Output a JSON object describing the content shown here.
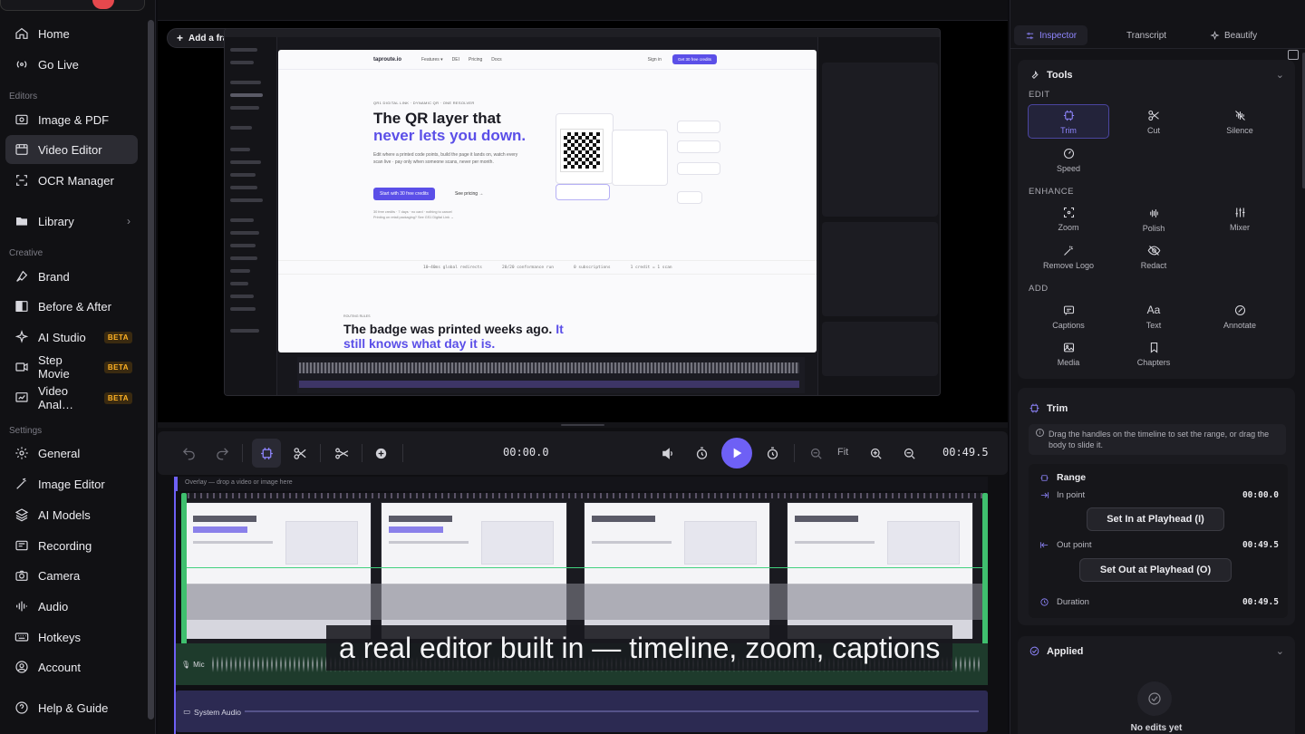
{
  "sidebar": {
    "items_top": [
      {
        "label": "Home",
        "icon": "home-icon"
      },
      {
        "label": "Go Live",
        "icon": "broadcast-icon"
      }
    ],
    "sections": {
      "editors": "Editors",
      "creative": "Creative",
      "settings": "Settings"
    },
    "editors": [
      {
        "label": "Image & PDF",
        "icon": "image-icon"
      },
      {
        "label": "Video Editor",
        "icon": "film-icon",
        "active": true
      },
      {
        "label": "OCR Manager",
        "icon": "scan-icon"
      }
    ],
    "library": {
      "label": "Library",
      "icon": "folder-icon"
    },
    "creative": [
      {
        "label": "Brand",
        "icon": "brush-icon"
      },
      {
        "label": "Before & After",
        "icon": "split-icon"
      },
      {
        "label": "AI Studio",
        "icon": "sparkle-icon",
        "badge": "BETA"
      },
      {
        "label": "Step Movie",
        "icon": "steps-icon",
        "badge": "BETA"
      },
      {
        "label": "Video Anal…",
        "icon": "chart-icon",
        "badge": "BETA"
      }
    ],
    "settings": [
      {
        "label": "General",
        "icon": "gear-icon"
      },
      {
        "label": "Image Editor",
        "icon": "wand-icon"
      },
      {
        "label": "AI Models",
        "icon": "layers-icon"
      },
      {
        "label": "Recording",
        "icon": "record-icon"
      },
      {
        "label": "Camera",
        "icon": "camera-icon"
      },
      {
        "label": "Audio",
        "icon": "audio-icon"
      },
      {
        "label": "Hotkeys",
        "icon": "keyboard-icon"
      },
      {
        "label": "Account",
        "icon": "user-icon"
      }
    ],
    "help": {
      "label": "Help & Guide",
      "icon": "help-icon"
    }
  },
  "preview": {
    "add_frame_label": "Add a frame",
    "webpage": {
      "logo": "taproute.io",
      "nav_links": [
        "Features ▾",
        "DEI",
        "Pricing",
        "Docs"
      ],
      "sign_in": "Sign in",
      "cta": "Get 30 free credits",
      "kicker": "QR1 DIGITAL LINK · DYNAMIC QR · ONE RESOLVER",
      "headline_1": "The QR layer that",
      "headline_2": "never lets you down.",
      "subtext": "Edit where a printed code points, build the page it lands on, watch every scan live · pay only when someone scans, never per month.",
      "primary_button": "Start with 30 free credits",
      "secondary_link": "See pricing →",
      "fine_print_1": "30 free credits · 7 days · no card · nothing to cancel",
      "fine_print_2": "Printing on retail packaging? See GS1 Digital Link →",
      "stats": [
        "10–40ms global redirects",
        "20/20 conformance run",
        "0 subscriptions",
        "1 credit = 1 scan"
      ],
      "kicker_2": "ROUTING RULES",
      "headline2_1": "The badge was printed weeks ago.",
      "headline2_2": "It still knows what day it is."
    }
  },
  "toolbar": {
    "current_time": "00:00.0",
    "total_time": "00:49.5",
    "fit_label": "Fit"
  },
  "timeline": {
    "overlay_label": "Overlay — drop a video or image here",
    "mic_label": "Mic",
    "system_audio_label": "System Audio",
    "caption": "a real editor built in — timeline, zoom, captions"
  },
  "inspector": {
    "tabs": [
      {
        "label": "Inspector",
        "icon": "sliders-icon"
      },
      {
        "label": "Transcript",
        "icon": "text-icon"
      },
      {
        "label": "Beautify",
        "icon": "sparkle-icon"
      }
    ],
    "tools_title": "Tools",
    "groups": {
      "edit": "EDIT",
      "enhance": "ENHANCE",
      "add": "ADD"
    },
    "edit_tools": [
      {
        "label": "Trim",
        "icon": "trim-icon",
        "active": true
      },
      {
        "label": "Cut",
        "icon": "scissors-icon"
      },
      {
        "label": "Silence",
        "icon": "silence-icon"
      },
      {
        "label": "Speed",
        "icon": "speed-icon"
      }
    ],
    "enhance_tools": [
      {
        "label": "Zoom",
        "icon": "zoom-icon"
      },
      {
        "label": "Polish",
        "icon": "polish-icon"
      },
      {
        "label": "Mixer",
        "icon": "mixer-icon"
      },
      {
        "label": "Remove Logo",
        "icon": "remove-logo-icon"
      },
      {
        "label": "Redact",
        "icon": "eye-off-icon"
      }
    ],
    "add_tools": [
      {
        "label": "Captions",
        "icon": "captions-icon"
      },
      {
        "label": "Text",
        "icon": "text-aa-icon",
        "glyph": "Aa"
      },
      {
        "label": "Annotate",
        "icon": "annotate-icon"
      },
      {
        "label": "Media",
        "icon": "media-icon"
      },
      {
        "label": "Chapters",
        "icon": "bookmark-icon"
      }
    ],
    "trim": {
      "title": "Trim",
      "hint": "Drag the handles on the timeline to set the range, or drag the body to slide it.",
      "range_title": "Range",
      "in_point_label": "In point",
      "in_point_value": "00:00.0",
      "set_in_button": "Set In at Playhead (I)",
      "out_point_label": "Out point",
      "out_point_value": "00:49.5",
      "set_out_button": "Set Out at Playhead (O)",
      "duration_label": "Duration",
      "duration_value": "00:49.5"
    },
    "applied": {
      "title": "Applied",
      "empty_text": "No edits yet"
    }
  },
  "colors": {
    "accent": "#6e60f5",
    "accent_light": "#8f86ff",
    "trim_green": "#3fbf6e",
    "beta_badge": "#ffb224"
  }
}
